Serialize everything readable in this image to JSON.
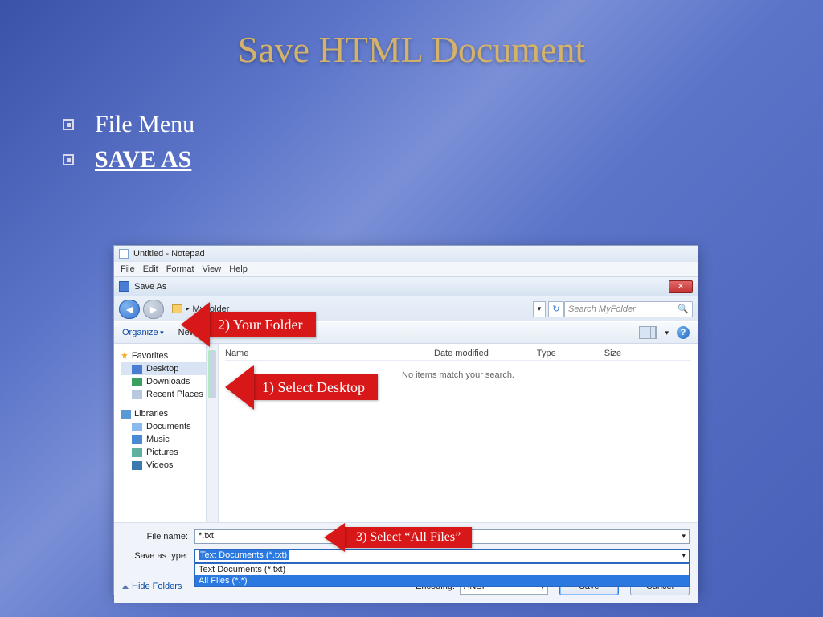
{
  "slide": {
    "title": "Save HTML Document",
    "bullet1": "File Menu",
    "bullet2": "SAVE AS"
  },
  "notepad": {
    "title": "Untitled - Notepad",
    "menu": {
      "file": "File",
      "edit": "Edit",
      "format": "Format",
      "view": "View",
      "help": "Help"
    }
  },
  "dialog": {
    "title": "Save As",
    "breadcrumb": "MyFolder",
    "search_placeholder": "Search MyFolder",
    "toolbar": {
      "organize": "Organize",
      "newfolder": "New folder"
    },
    "tree": {
      "favorites": "Favorites",
      "desktop": "Desktop",
      "downloads": "Downloads",
      "recent": "Recent Places",
      "libraries": "Libraries",
      "documents": "Documents",
      "music": "Music",
      "pictures": "Pictures",
      "videos": "Videos"
    },
    "columns": {
      "name": "Name",
      "date": "Date modified",
      "type": "Type",
      "size": "Size"
    },
    "empty_msg": "No items match your search.",
    "filename_label": "File name:",
    "filename_value": "*.txt",
    "filetype_label": "Save as type:",
    "filetype_value": "Text Documents (*.txt)",
    "filetype_options": {
      "txt": "Text Documents (*.txt)",
      "all": "All Files  (*.*)"
    },
    "hide_folders": "Hide Folders",
    "encoding_label": "Encoding:",
    "encoding_value": "ANSI",
    "save_btn": "Save",
    "cancel_btn": "Cancel"
  },
  "callouts": {
    "one": "1) Select Desktop",
    "two": "2)  Your Folder",
    "three": "3) Select “All Files”"
  }
}
